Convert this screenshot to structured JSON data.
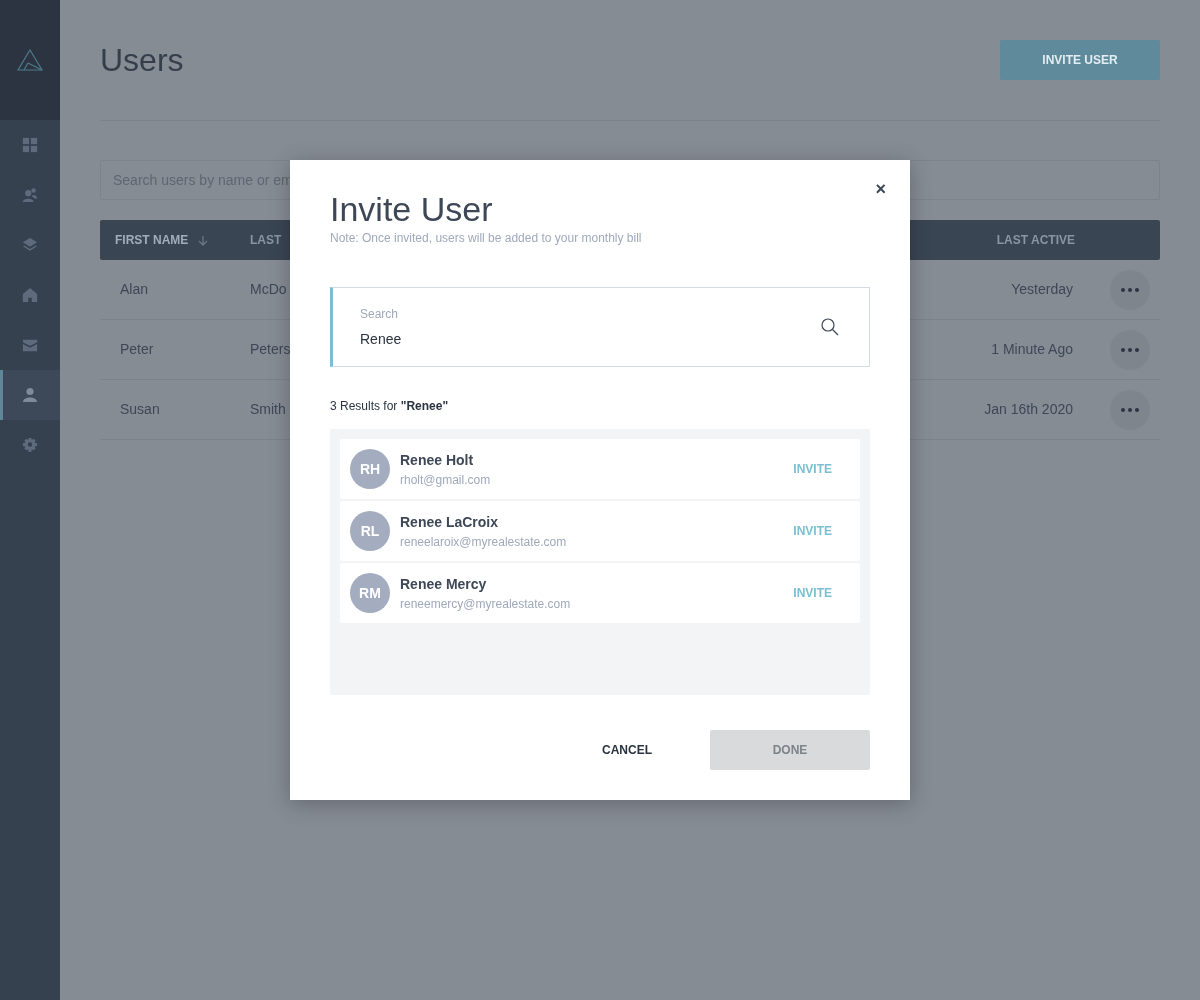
{
  "sidebar": {
    "items": [
      {
        "kind": "dashboard",
        "selected": false
      },
      {
        "kind": "contacts",
        "selected": false
      },
      {
        "kind": "layers",
        "selected": false
      },
      {
        "kind": "home",
        "selected": false
      },
      {
        "kind": "mail",
        "selected": false
      },
      {
        "kind": "user",
        "selected": true
      },
      {
        "kind": "settings",
        "selected": false
      }
    ]
  },
  "page": {
    "title": "Users",
    "invite_button": "INVITE USER",
    "search": {
      "placeholder": "Search users by name or em"
    }
  },
  "table": {
    "columns": [
      {
        "label": "FIRST NAME",
        "sorted": true
      },
      {
        "label": "LAST",
        "sorted": false
      },
      {
        "label": "LAST ACTIVE",
        "sorted": false
      }
    ],
    "rows": [
      [
        "Alan",
        "McDo",
        "Yesterday"
      ],
      [
        "Peter",
        "Peters",
        "1 Minute Ago"
      ],
      [
        "Susan",
        "Smith",
        "Jan 16th 2020"
      ]
    ]
  },
  "dialog": {
    "title": "Invite User",
    "note": "Note: Once invited, users will be added to your monthly bill",
    "close": "×",
    "search": {
      "label": "Search",
      "value": "Renee"
    },
    "results_summary": "3 Results for **\"Renee\"**",
    "results": [
      {
        "initials": "RH",
        "name": "Renee Holt",
        "email": "rholt@gmail.com",
        "action": "INVITE"
      },
      {
        "initials": "RL",
        "name": "Renee LaCroix",
        "email": "reneelaroix@myrealestate.com",
        "action": "INVITE"
      },
      {
        "initials": "RM",
        "name": "Renee Mercy",
        "email": "reneemercy@myrealestate.com",
        "action": "INVITE"
      }
    ],
    "cancel": "CANCEL",
    "done": {
      "label": "DONE",
      "disabled": true
    }
  }
}
